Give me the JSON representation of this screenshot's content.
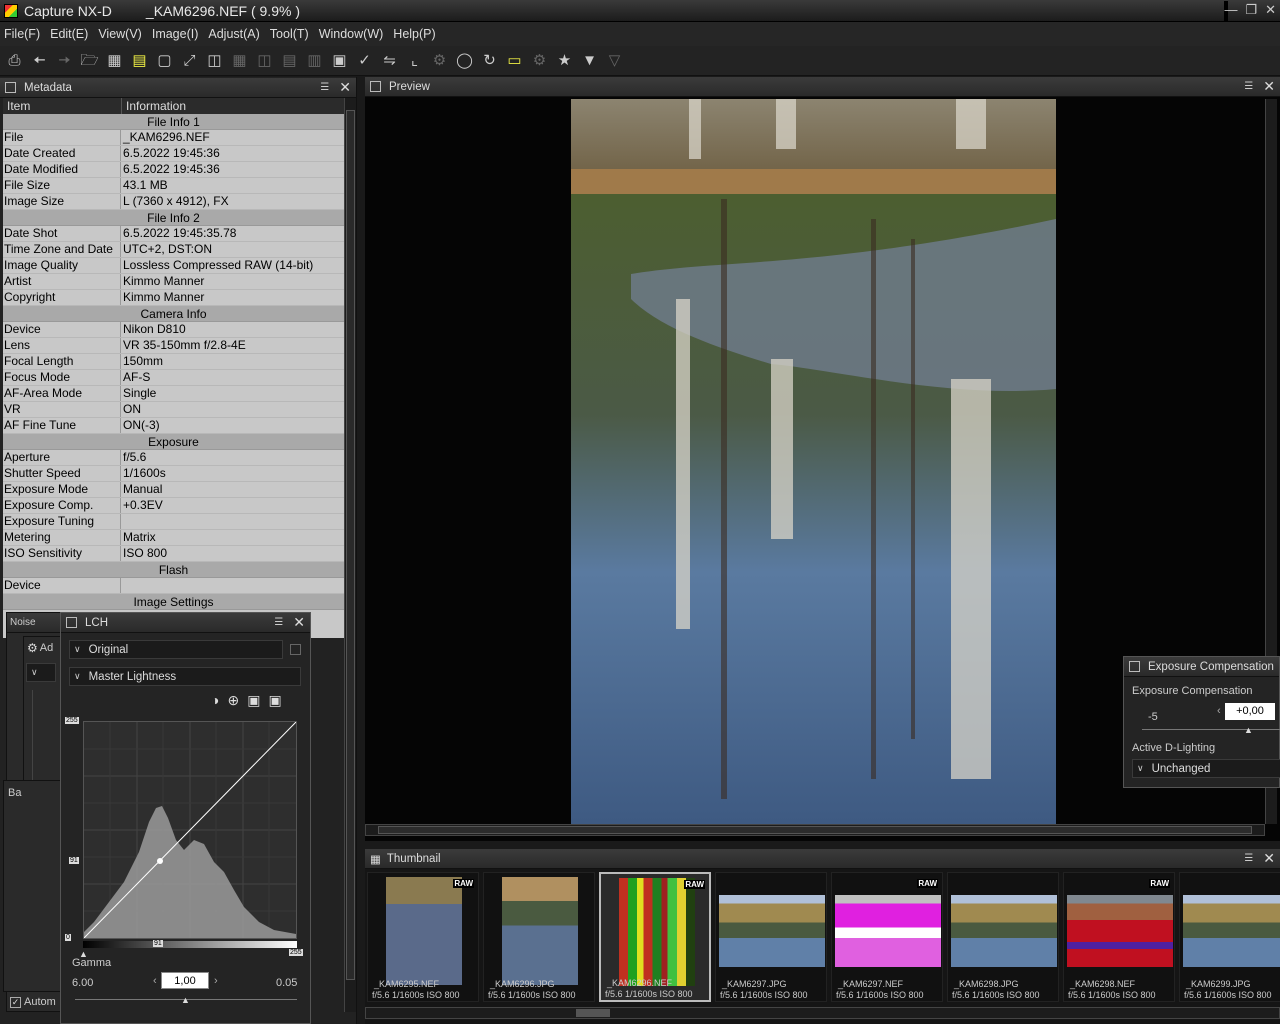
{
  "window": {
    "app_name": "Capture NX-D",
    "document": "_KAM6296.NEF ( 9.9% )"
  },
  "menu": [
    "File(F)",
    "Edit(E)",
    "View(V)",
    "Image(I)",
    "Adjust(A)",
    "Tool(T)",
    "Window(W)",
    "Help(P)"
  ],
  "metadata_panel": {
    "title": "Metadata",
    "col_item": "Item",
    "col_info": "Information",
    "rows": [
      {
        "section": "File Info 1"
      },
      {
        "k": "File",
        "v": "_KAM6296.NEF"
      },
      {
        "k": "Date Created",
        "v": "6.5.2022 19:45:36"
      },
      {
        "k": "Date Modified",
        "v": "6.5.2022 19:45:36"
      },
      {
        "k": "File Size",
        "v": "43.1 MB"
      },
      {
        "k": "Image Size",
        "v": "L (7360 x 4912), FX"
      },
      {
        "section": "File Info 2"
      },
      {
        "k": "Date Shot",
        "v": "6.5.2022 19:45:35.78"
      },
      {
        "k": "Time Zone and Date",
        "v": "UTC+2, DST:ON"
      },
      {
        "k": "Image Quality",
        "v": "Lossless Compressed RAW (14-bit)"
      },
      {
        "k": "Artist",
        "v": "Kimmo Manner"
      },
      {
        "k": "Copyright",
        "v": "Kimmo Manner"
      },
      {
        "section": "Camera Info"
      },
      {
        "k": "Device",
        "v": "Nikon D810"
      },
      {
        "k": "Lens",
        "v": "VR 35-150mm f/2.8-4E"
      },
      {
        "k": "Focal Length",
        "v": "150mm"
      },
      {
        "k": "Focus Mode",
        "v": "AF-S"
      },
      {
        "k": "AF-Area Mode",
        "v": "Single"
      },
      {
        "k": "VR",
        "v": "ON"
      },
      {
        "k": "AF Fine Tune",
        "v": "ON(-3)"
      },
      {
        "section": "Exposure"
      },
      {
        "k": "Aperture",
        "v": "f/5.6"
      },
      {
        "k": "Shutter Speed",
        "v": "1/1600s"
      },
      {
        "k": "Exposure Mode",
        "v": "Manual"
      },
      {
        "k": "Exposure Comp.",
        "v": "+0.3EV"
      },
      {
        "k": "Exposure Tuning",
        "v": ""
      },
      {
        "k": "Metering",
        "v": "Matrix"
      },
      {
        "k": "ISO Sensitivity",
        "v": "ISO 800"
      },
      {
        "section": "Flash"
      },
      {
        "k": "Device",
        "v": "",
        "nobreak": true
      },
      {
        "section": "Image Settings"
      }
    ]
  },
  "background_palettes": {
    "noise_title": "Noise",
    "adjust_title": "Ad",
    "batch_title": "Ba",
    "auto_label": "Autom"
  },
  "lch_panel": {
    "title": "LCH",
    "preset": "Original",
    "channel": "Master Lightness",
    "in_max": "255",
    "in_mid": "91",
    "in_min": "0",
    "out_mid": "91",
    "out_max": "255",
    "gamma_label": "Gamma",
    "gamma_min": "6.00",
    "gamma_value": "1,00",
    "gamma_max": "0.05"
  },
  "preview_panel": {
    "title": "Preview"
  },
  "thumbnail_panel": {
    "title": "Thumbnail",
    "items": [
      {
        "name": "_KAM6295.NEF",
        "info": "f/5.6 1/1600s ISO 800",
        "raw": "RAW",
        "kind": "portrait",
        "style": "a"
      },
      {
        "name": "_KAM6296.JPG",
        "info": "f/5.6 1/1600s ISO 800",
        "raw": "",
        "kind": "portrait",
        "style": "b"
      },
      {
        "name": "_KAM6296.NEF",
        "info": "f/5.6 1/1600s ISO 800",
        "raw": "RAW",
        "kind": "portrait",
        "style": "glitch",
        "selected": true
      },
      {
        "name": "_KAM6297.JPG",
        "info": "f/5.6 1/1600s ISO 800",
        "raw": "",
        "kind": "land",
        "style": "land"
      },
      {
        "name": "_KAM6297.NEF",
        "info": "f/5.6 1/1600s ISO 800",
        "raw": "RAW",
        "kind": "land",
        "style": "magenta"
      },
      {
        "name": "_KAM6298.JPG",
        "info": "f/5.6 1/1600s ISO 800",
        "raw": "",
        "kind": "land",
        "style": "land"
      },
      {
        "name": "_KAM6298.NEF",
        "info": "f/5.6 1/1600s ISO 800",
        "raw": "RAW",
        "kind": "land",
        "style": "red"
      },
      {
        "name": "_KAM6299.JPG",
        "info": "f/5.6 1/1600s ISO 800",
        "raw": "",
        "kind": "land",
        "style": "land"
      }
    ]
  },
  "exposure_panel": {
    "title": "Exposure Compensation",
    "label": "Exposure Compensation",
    "min": "-5",
    "value": "+0,00",
    "dlighting_label": "Active D-Lighting",
    "dlighting_value": "Unchanged"
  },
  "colors": {
    "highlight_icon": "#eeee44",
    "metadata_bg": "#c8c8c8",
    "section_bg": "#a9a9a9"
  }
}
